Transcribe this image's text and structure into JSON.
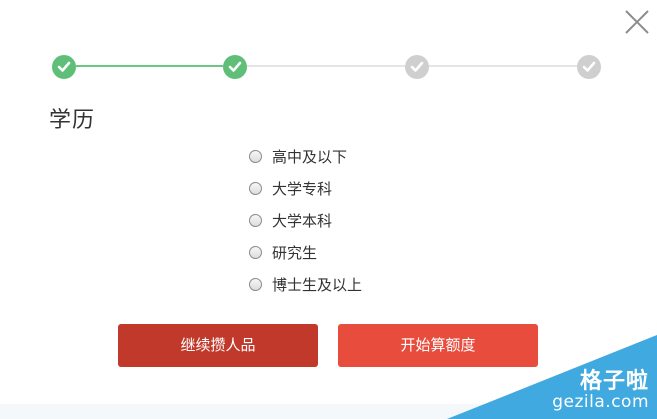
{
  "dialog": {
    "close_icon": "close-icon",
    "section_title": "学历"
  },
  "stepper": {
    "steps": [
      {
        "state": "completed",
        "icon": "check-icon"
      },
      {
        "state": "completed",
        "icon": "check-icon"
      },
      {
        "state": "pending",
        "icon": "check-icon"
      },
      {
        "state": "pending",
        "icon": "check-icon"
      }
    ],
    "colors": {
      "completed": "#5fbf79",
      "pending": "#cfcfcf"
    }
  },
  "education_options": [
    {
      "label": "高中及以下",
      "selected": false
    },
    {
      "label": "大学专科",
      "selected": false
    },
    {
      "label": "大学本科",
      "selected": false
    },
    {
      "label": "研究生",
      "selected": false
    },
    {
      "label": "博士生及以上",
      "selected": false
    }
  ],
  "buttons": {
    "continue_label": "继续攒人品",
    "start_label": "开始算额度",
    "continue_color": "#c0392b",
    "start_color": "#e74c3c"
  },
  "watermark": {
    "title": "格子啦",
    "url": "gezila.com",
    "color": "#3fa9e0"
  }
}
